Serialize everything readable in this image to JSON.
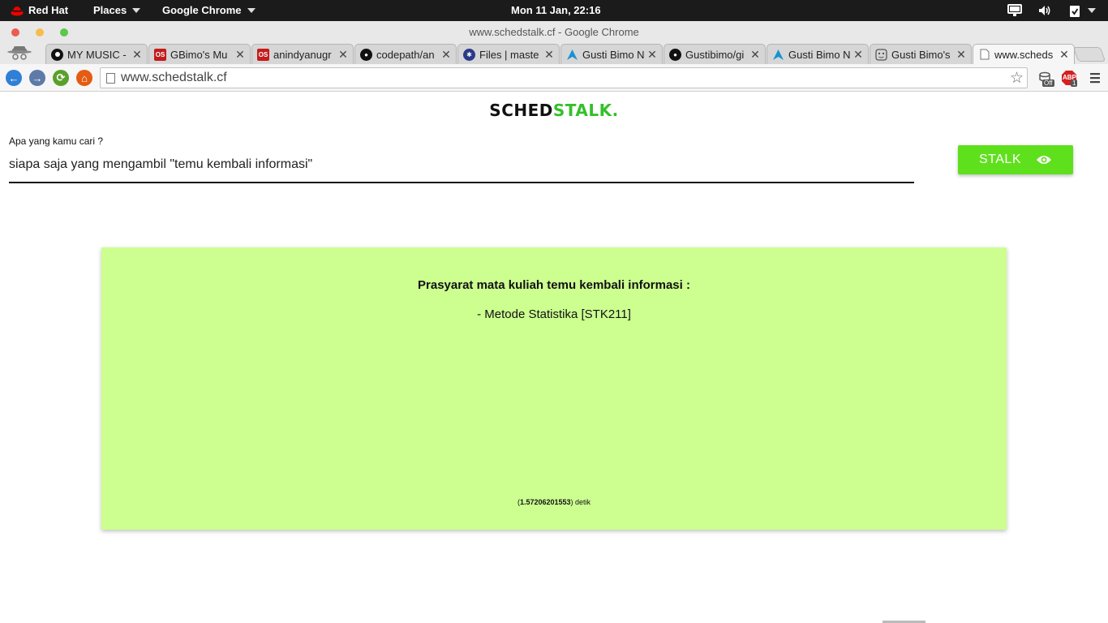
{
  "topbar": {
    "distro": "Red Hat",
    "places": "Places",
    "app": "Google Chrome",
    "clock": "Mon 11 Jan, 22:16"
  },
  "window": {
    "title": "www.schedstalk.cf - Google Chrome"
  },
  "tabs": [
    {
      "label": "MY MUSIC -",
      "favicon": "music-icon",
      "color": "#111111"
    },
    {
      "label": "GBimo's Mu",
      "favicon": "os-icon",
      "color": "#c41b1b"
    },
    {
      "label": "anindyanugr",
      "favicon": "os-icon",
      "color": "#c41b1b"
    },
    {
      "label": "codepath/an",
      "favicon": "github-icon",
      "color": "#111111"
    },
    {
      "label": "Files | maste",
      "favicon": "files-icon",
      "color": "#2a3a8a"
    },
    {
      "label": "Gusti Bimo N",
      "favicon": "arch-icon",
      "color": "#1793d1"
    },
    {
      "label": "Gustibimo/gi",
      "favicon": "github-icon",
      "color": "#111111"
    },
    {
      "label": "Gusti Bimo N",
      "favicon": "arch-icon",
      "color": "#1793d1"
    },
    {
      "label": "Gusti Bimo's",
      "favicon": "face-icon",
      "color": "#555555"
    },
    {
      "label": "www.scheds",
      "favicon": "page-icon",
      "color": "#777777",
      "active": true
    }
  ],
  "toolbar": {
    "url": "www.schedstalk.cf",
    "ext_off_badge": "Off",
    "abp_label": "ABP",
    "abp_count": "1"
  },
  "page": {
    "logo_part1": "SCHED",
    "logo_part2": "STALK.",
    "search_label": "Apa yang kamu cari ?",
    "search_value": "siapa saja yang mengambil \"temu kembali informasi\"",
    "stalk_button": "STALK",
    "result_heading": "Prasyarat mata kuliah temu kembali informasi :",
    "result_item": "- Metode Statistika [STK211]",
    "timing_open": "(",
    "timing_value": "1.57206201553",
    "timing_close": ") detik"
  },
  "colors": {
    "accent_green": "#5fe01c",
    "card_bg": "#ccff90",
    "logo_green": "#34c02a"
  }
}
